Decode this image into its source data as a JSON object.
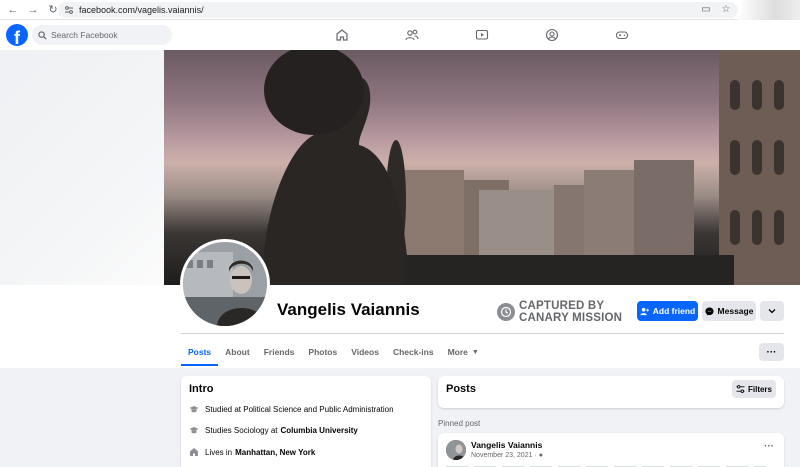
{
  "browser": {
    "url": "facebook.com/vagelis.vaiannis/"
  },
  "nav": {
    "logo_letter": "f",
    "search_placeholder": "Search Facebook"
  },
  "profile": {
    "name": "Vangelis Vaiannis",
    "badge_line1": "CAPTURED BY",
    "badge_line2": "CANARY MISSION",
    "add_friend_label": "Add friend",
    "message_label": "Message",
    "more_dots": "···"
  },
  "tabs": [
    {
      "label": "Posts"
    },
    {
      "label": "About"
    },
    {
      "label": "Friends"
    },
    {
      "label": "Photos"
    },
    {
      "label": "Videos"
    },
    {
      "label": "Check-ins"
    },
    {
      "label": "More"
    }
  ],
  "intro": {
    "title": "Intro",
    "items": [
      {
        "prefix": "Studied at Political Science and Public Administration",
        "bold": ""
      },
      {
        "prefix": "Studies Sociology at",
        "bold": "Columbia University"
      },
      {
        "prefix": "Lives in",
        "bold": "Manhattan, New York"
      }
    ]
  },
  "posts": {
    "title": "Posts",
    "filters_label": "Filters",
    "pinned_label": "Pinned post",
    "post_author": "Vangelis Vaiannis",
    "post_date": "November 23, 2021 ·",
    "post_menu": "···"
  },
  "colors": {
    "brand_blue": "#0866ff",
    "badge_gray": "#65676b"
  }
}
